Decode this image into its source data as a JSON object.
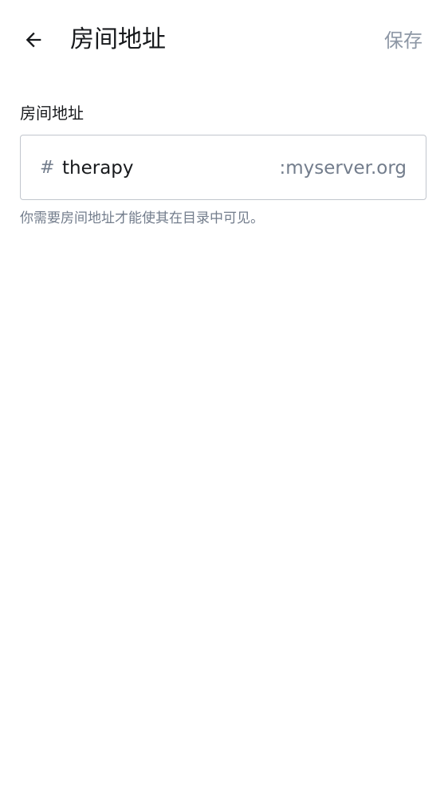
{
  "header": {
    "title": "房间地址",
    "save_label": "保存",
    "back_icon": "arrow-left-icon"
  },
  "field": {
    "label": "房间地址",
    "prefix": "#",
    "value": "therapy",
    "suffix": ":myserver.org",
    "helper": "你需要房间地址才能使其在目录中可见。"
  },
  "colors": {
    "title": "#17191c",
    "muted": "#737d8c",
    "save_disabled": "#8d97a5",
    "border": "#c1c6cd",
    "background": "#ffffff"
  }
}
